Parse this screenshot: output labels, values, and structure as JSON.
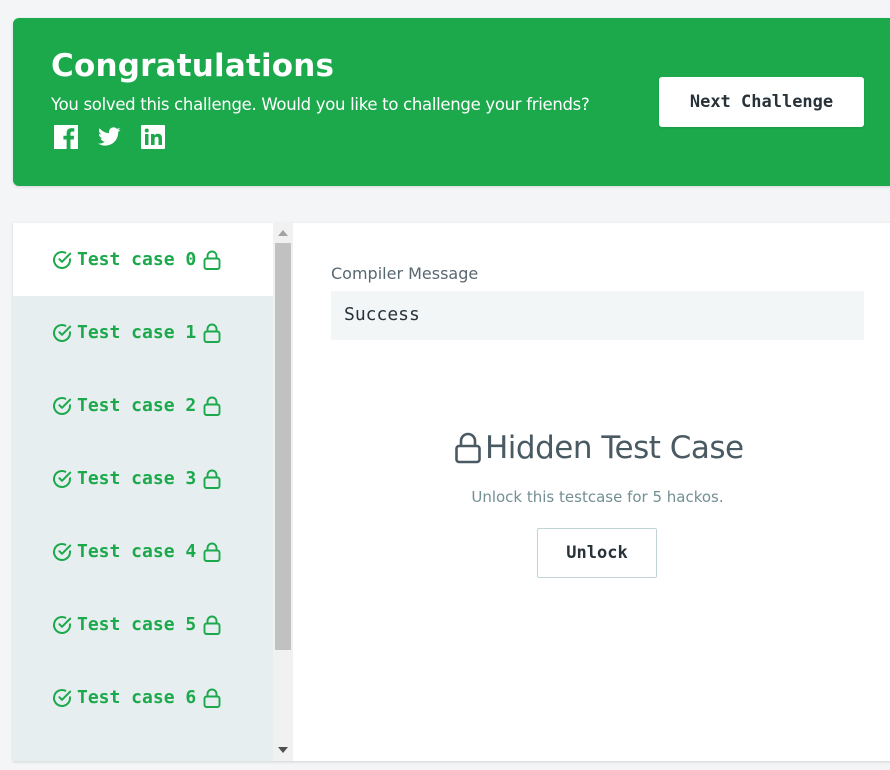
{
  "banner": {
    "title": "Congratulations",
    "subtitle": "You solved this challenge. Would you like to challenge your friends?",
    "social": [
      "facebook-icon",
      "twitter-icon",
      "linkedin-icon"
    ],
    "next_label": "Next Challenge",
    "color": "#1ba94c"
  },
  "testcases": [
    {
      "label": "Test case 0",
      "status": "passed",
      "locked": true,
      "active": true
    },
    {
      "label": "Test case 1",
      "status": "passed",
      "locked": true,
      "active": false
    },
    {
      "label": "Test case 2",
      "status": "passed",
      "locked": true,
      "active": false
    },
    {
      "label": "Test case 3",
      "status": "passed",
      "locked": true,
      "active": false
    },
    {
      "label": "Test case 4",
      "status": "passed",
      "locked": true,
      "active": false
    },
    {
      "label": "Test case 5",
      "status": "passed",
      "locked": true,
      "active": false
    },
    {
      "label": "Test case 6",
      "status": "passed",
      "locked": true,
      "active": false
    }
  ],
  "compiler": {
    "label": "Compiler Message",
    "message": "Success"
  },
  "hidden": {
    "title": "Hidden Test Case",
    "description": "Unlock this testcase for 5 hackos.",
    "unlock_label": "Unlock"
  }
}
